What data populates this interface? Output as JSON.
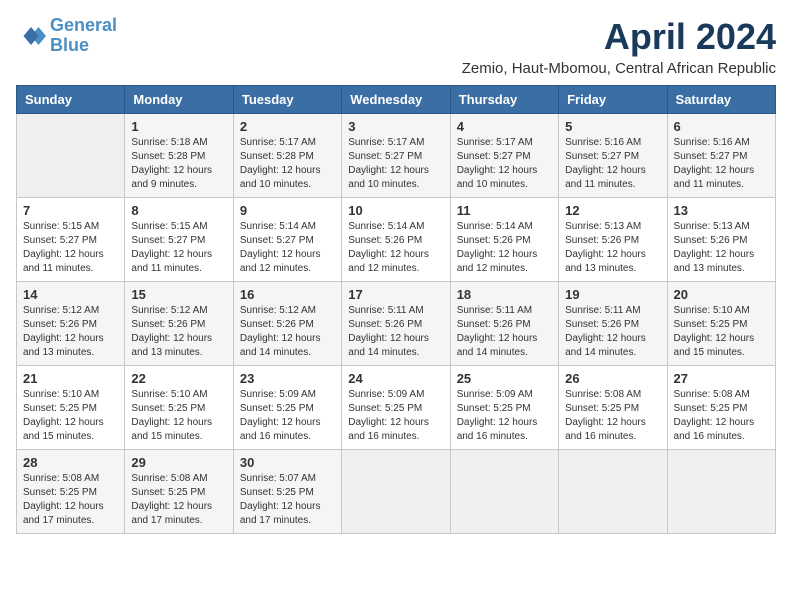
{
  "logo": {
    "line1": "General",
    "line2": "Blue"
  },
  "title": "April 2024",
  "location": "Zemio, Haut-Mbomou, Central African Republic",
  "weekdays": [
    "Sunday",
    "Monday",
    "Tuesday",
    "Wednesday",
    "Thursday",
    "Friday",
    "Saturday"
  ],
  "weeks": [
    [
      {
        "day": "",
        "info": ""
      },
      {
        "day": "1",
        "info": "Sunrise: 5:18 AM\nSunset: 5:28 PM\nDaylight: 12 hours\nand 9 minutes."
      },
      {
        "day": "2",
        "info": "Sunrise: 5:17 AM\nSunset: 5:28 PM\nDaylight: 12 hours\nand 10 minutes."
      },
      {
        "day": "3",
        "info": "Sunrise: 5:17 AM\nSunset: 5:27 PM\nDaylight: 12 hours\nand 10 minutes."
      },
      {
        "day": "4",
        "info": "Sunrise: 5:17 AM\nSunset: 5:27 PM\nDaylight: 12 hours\nand 10 minutes."
      },
      {
        "day": "5",
        "info": "Sunrise: 5:16 AM\nSunset: 5:27 PM\nDaylight: 12 hours\nand 11 minutes."
      },
      {
        "day": "6",
        "info": "Sunrise: 5:16 AM\nSunset: 5:27 PM\nDaylight: 12 hours\nand 11 minutes."
      }
    ],
    [
      {
        "day": "7",
        "info": "Sunrise: 5:15 AM\nSunset: 5:27 PM\nDaylight: 12 hours\nand 11 minutes."
      },
      {
        "day": "8",
        "info": "Sunrise: 5:15 AM\nSunset: 5:27 PM\nDaylight: 12 hours\nand 11 minutes."
      },
      {
        "day": "9",
        "info": "Sunrise: 5:14 AM\nSunset: 5:27 PM\nDaylight: 12 hours\nand 12 minutes."
      },
      {
        "day": "10",
        "info": "Sunrise: 5:14 AM\nSunset: 5:26 PM\nDaylight: 12 hours\nand 12 minutes."
      },
      {
        "day": "11",
        "info": "Sunrise: 5:14 AM\nSunset: 5:26 PM\nDaylight: 12 hours\nand 12 minutes."
      },
      {
        "day": "12",
        "info": "Sunrise: 5:13 AM\nSunset: 5:26 PM\nDaylight: 12 hours\nand 13 minutes."
      },
      {
        "day": "13",
        "info": "Sunrise: 5:13 AM\nSunset: 5:26 PM\nDaylight: 12 hours\nand 13 minutes."
      }
    ],
    [
      {
        "day": "14",
        "info": "Sunrise: 5:12 AM\nSunset: 5:26 PM\nDaylight: 12 hours\nand 13 minutes."
      },
      {
        "day": "15",
        "info": "Sunrise: 5:12 AM\nSunset: 5:26 PM\nDaylight: 12 hours\nand 13 minutes."
      },
      {
        "day": "16",
        "info": "Sunrise: 5:12 AM\nSunset: 5:26 PM\nDaylight: 12 hours\nand 14 minutes."
      },
      {
        "day": "17",
        "info": "Sunrise: 5:11 AM\nSunset: 5:26 PM\nDaylight: 12 hours\nand 14 minutes."
      },
      {
        "day": "18",
        "info": "Sunrise: 5:11 AM\nSunset: 5:26 PM\nDaylight: 12 hours\nand 14 minutes."
      },
      {
        "day": "19",
        "info": "Sunrise: 5:11 AM\nSunset: 5:26 PM\nDaylight: 12 hours\nand 14 minutes."
      },
      {
        "day": "20",
        "info": "Sunrise: 5:10 AM\nSunset: 5:25 PM\nDaylight: 12 hours\nand 15 minutes."
      }
    ],
    [
      {
        "day": "21",
        "info": "Sunrise: 5:10 AM\nSunset: 5:25 PM\nDaylight: 12 hours\nand 15 minutes."
      },
      {
        "day": "22",
        "info": "Sunrise: 5:10 AM\nSunset: 5:25 PM\nDaylight: 12 hours\nand 15 minutes."
      },
      {
        "day": "23",
        "info": "Sunrise: 5:09 AM\nSunset: 5:25 PM\nDaylight: 12 hours\nand 16 minutes."
      },
      {
        "day": "24",
        "info": "Sunrise: 5:09 AM\nSunset: 5:25 PM\nDaylight: 12 hours\nand 16 minutes."
      },
      {
        "day": "25",
        "info": "Sunrise: 5:09 AM\nSunset: 5:25 PM\nDaylight: 12 hours\nand 16 minutes."
      },
      {
        "day": "26",
        "info": "Sunrise: 5:08 AM\nSunset: 5:25 PM\nDaylight: 12 hours\nand 16 minutes."
      },
      {
        "day": "27",
        "info": "Sunrise: 5:08 AM\nSunset: 5:25 PM\nDaylight: 12 hours\nand 16 minutes."
      }
    ],
    [
      {
        "day": "28",
        "info": "Sunrise: 5:08 AM\nSunset: 5:25 PM\nDaylight: 12 hours\nand 17 minutes."
      },
      {
        "day": "29",
        "info": "Sunrise: 5:08 AM\nSunset: 5:25 PM\nDaylight: 12 hours\nand 17 minutes."
      },
      {
        "day": "30",
        "info": "Sunrise: 5:07 AM\nSunset: 5:25 PM\nDaylight: 12 hours\nand 17 minutes."
      },
      {
        "day": "",
        "info": ""
      },
      {
        "day": "",
        "info": ""
      },
      {
        "day": "",
        "info": ""
      },
      {
        "day": "",
        "info": ""
      }
    ]
  ]
}
